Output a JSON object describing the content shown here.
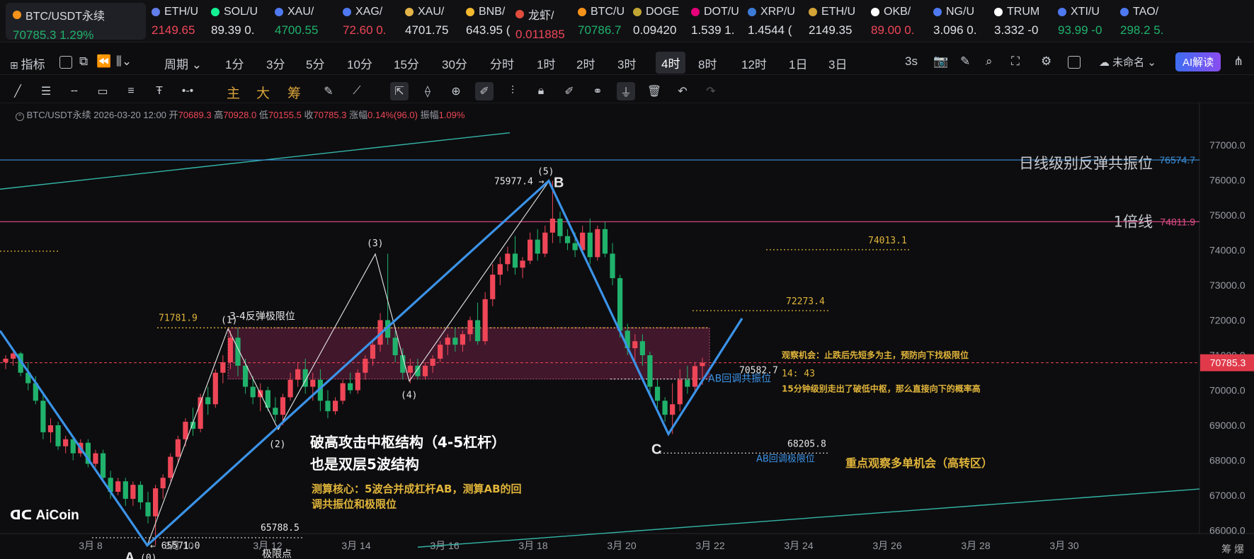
{
  "ticker": [
    {
      "name": "BTC/USDT永续",
      "price": "70785.3",
      "change": "1.29%",
      "dir": "up",
      "color": "#f7931a"
    },
    {
      "name": "ETH/U",
      "price": "2149.65",
      "change": "",
      "dir": "dn",
      "color": "#627eea"
    },
    {
      "name": "SOL/U",
      "price": "89.39",
      "change": "0.",
      "dir": "wt",
      "color": "#14f195"
    },
    {
      "name": "XAU/",
      "price": "4700.55",
      "change": "",
      "dir": "up",
      "color": "#4e79f0"
    },
    {
      "name": "XAG/",
      "price": "72.60",
      "change": "0.",
      "dir": "dn",
      "color": "#4e79f0"
    },
    {
      "name": "XAU/",
      "price": "4701.75",
      "change": "",
      "dir": "wt",
      "color": "#e5b449"
    },
    {
      "name": "BNB/",
      "price": "643.95",
      "change": "(",
      "dir": "wt",
      "color": "#f3ba2f"
    },
    {
      "name": "龙虾/",
      "price": "0.011885",
      "change": "",
      "dir": "dn",
      "color": "#e14d3c"
    },
    {
      "name": "BTC/U",
      "price": "70786.7",
      "change": "",
      "dir": "up",
      "color": "#f7931a"
    },
    {
      "name": "DOGE",
      "price": "0.09420",
      "change": "",
      "dir": "wt",
      "color": "#c2a633"
    },
    {
      "name": "DOT/U",
      "price": "1.539",
      "change": "1.",
      "dir": "wt",
      "color": "#e6007a"
    },
    {
      "name": "XRP/U",
      "price": "1.4544",
      "change": "(",
      "dir": "wt",
      "color": "#3d7bd8"
    },
    {
      "name": "ETH/U",
      "price": "2149.35",
      "change": "",
      "dir": "wt",
      "color": "#d4a437"
    },
    {
      "name": "OKB/",
      "price": "89.00",
      "change": "0.",
      "dir": "dn",
      "color": "#ffffff"
    },
    {
      "name": "NG/U",
      "price": "3.096",
      "change": "0.",
      "dir": "wt",
      "color": "#4e79f0"
    },
    {
      "name": "TRUM",
      "price": "3.332",
      "change": "-0",
      "dir": "wt",
      "color": "#ffffff"
    },
    {
      "name": "XTI/U",
      "price": "93.99",
      "change": "-0",
      "dir": "up",
      "color": "#4e79f0"
    },
    {
      "name": "TAO/",
      "price": "298.2",
      "change": "5.",
      "dir": "up",
      "color": "#4e79f0"
    }
  ],
  "toolbar": {
    "indicator": "指标",
    "period": "周期",
    "intervals": [
      "1分",
      "3分",
      "5分",
      "10分",
      "15分",
      "30分",
      "分时",
      "1时",
      "2时",
      "3时",
      "4时",
      "8时",
      "12时",
      "1日",
      "3日"
    ],
    "active_interval": "4时",
    "refresh": "3s",
    "layout_name": "未命名",
    "ai_button": "AI解读"
  },
  "drawbar": {
    "main": "主",
    "big": "大",
    "chip": "筹"
  },
  "info": {
    "symbol": "BTC/USDT永续",
    "time": "2026-03-20 12:00",
    "open_label": "开",
    "open": "70689.3",
    "high_label": "高",
    "high": "70928.0",
    "low_label": "低",
    "low": "70155.5",
    "close_label": "收",
    "close": "70785.3",
    "change_label": "涨幅",
    "change": "0.14%(96.0)",
    "amp_label": "振幅",
    "amp": "1.09%"
  },
  "brand": "AiCoin",
  "corner": "筹 爆",
  "chart_data": {
    "type": "candlestick",
    "ylim": [
      65000,
      77300
    ],
    "y_ticks": [
      "77000.0",
      "76000.0",
      "75000.0",
      "74000.0",
      "73000.0",
      "72000.0",
      "71000.0",
      "70000.0",
      "69000.0",
      "68000.0",
      "67000.0",
      "66000.0"
    ],
    "x_ticks": [
      {
        "label": "3月 8",
        "day": 8
      },
      {
        "label": "3月 10",
        "day": 10
      },
      {
        "label": "3月 12",
        "day": 12
      },
      {
        "label": "3月 14",
        "day": 14
      },
      {
        "label": "3月 16",
        "day": 16
      },
      {
        "label": "3月 18",
        "day": 18
      },
      {
        "label": "3月 20",
        "day": 20
      },
      {
        "label": "3月 22",
        "day": 22
      },
      {
        "label": "3月 24",
        "day": 24
      },
      {
        "label": "3月 26",
        "day": 26
      },
      {
        "label": "3月 28",
        "day": 28
      },
      {
        "label": "3月 30",
        "day": 30
      }
    ],
    "last_price": "70785.3",
    "candles": [
      [
        70800,
        71000,
        70600,
        70900
      ],
      [
        70900,
        71100,
        70700,
        71050
      ],
      [
        71050,
        71100,
        70400,
        70500
      ],
      [
        70500,
        70800,
        70000,
        70200
      ],
      [
        70200,
        70400,
        69600,
        69700
      ],
      [
        69700,
        69900,
        68600,
        68800
      ],
      [
        68800,
        69200,
        68500,
        69000
      ],
      [
        69000,
        69100,
        68300,
        68400
      ],
      [
        68400,
        68700,
        68200,
        68600
      ],
      [
        68600,
        68700,
        68000,
        68200
      ],
      [
        68200,
        68600,
        68100,
        68500
      ],
      [
        68500,
        68600,
        67800,
        67900
      ],
      [
        67900,
        68300,
        67800,
        68200
      ],
      [
        68200,
        68300,
        67400,
        67500
      ],
      [
        67500,
        67700,
        66900,
        67100
      ],
      [
        67100,
        67500,
        67000,
        67400
      ],
      [
        67400,
        67500,
        66700,
        66900
      ],
      [
        66900,
        67400,
        66700,
        67300
      ],
      [
        67300,
        67400,
        66600,
        66800
      ],
      [
        66800,
        67100,
        66200,
        66400
      ],
      [
        66400,
        67300,
        65571,
        67200
      ],
      [
        67200,
        67600,
        66900,
        67500
      ],
      [
        67500,
        68200,
        67400,
        68100
      ],
      [
        68100,
        68700,
        67900,
        68600
      ],
      [
        68600,
        69200,
        68400,
        69100
      ],
      [
        69100,
        69500,
        68700,
        68900
      ],
      [
        68900,
        69900,
        68800,
        69800
      ],
      [
        69800,
        70100,
        69300,
        69600
      ],
      [
        69600,
        70600,
        69500,
        70500
      ],
      [
        70500,
        71000,
        70200,
        70800
      ],
      [
        70800,
        71700,
        70600,
        71500
      ],
      [
        71500,
        71782,
        70400,
        70700
      ],
      [
        70700,
        70900,
        69900,
        70100
      ],
      [
        70100,
        70400,
        69600,
        69800
      ],
      [
        69800,
        70200,
        69400,
        70000
      ],
      [
        70000,
        70100,
        69400,
        69500
      ],
      [
        69500,
        69800,
        69100,
        69300
      ],
      [
        69300,
        69900,
        69000,
        69800
      ],
      [
        69800,
        70500,
        69700,
        70300
      ],
      [
        70300,
        70800,
        70100,
        70600
      ],
      [
        70600,
        70900,
        69900,
        70100
      ],
      [
        70100,
        70500,
        69700,
        70300
      ],
      [
        70300,
        70600,
        69400,
        69700
      ],
      [
        69700,
        70000,
        69200,
        69400
      ],
      [
        69400,
        69800,
        69300,
        69700
      ],
      [
        69700,
        70300,
        69600,
        70200
      ],
      [
        70200,
        70500,
        69900,
        70000
      ],
      [
        70000,
        70600,
        69900,
        70500
      ],
      [
        70500,
        71000,
        70300,
        70900
      ],
      [
        70900,
        71400,
        70700,
        71300
      ],
      [
        71300,
        72200,
        71100,
        72000
      ],
      [
        72000,
        73900,
        71300,
        71500
      ],
      [
        71500,
        71700,
        70800,
        71000
      ],
      [
        71000,
        71200,
        70300,
        70500
      ],
      [
        70500,
        70900,
        70200,
        70700
      ],
      [
        70700,
        70900,
        70300,
        70400
      ],
      [
        70400,
        70800,
        70300,
        70700
      ],
      [
        70700,
        71000,
        70500,
        70900
      ],
      [
        70900,
        71400,
        70800,
        71300
      ],
      [
        71300,
        71600,
        71000,
        71500
      ],
      [
        71500,
        71800,
        71100,
        71300
      ],
      [
        71300,
        71700,
        71100,
        71600
      ],
      [
        71600,
        72100,
        71400,
        72000
      ],
      [
        72000,
        72500,
        71300,
        71400
      ],
      [
        71400,
        72800,
        71300,
        72600
      ],
      [
        72600,
        73600,
        72400,
        73300
      ],
      [
        73300,
        73800,
        73000,
        73600
      ],
      [
        73600,
        74100,
        73400,
        73900
      ],
      [
        73900,
        74400,
        73300,
        73500
      ],
      [
        73500,
        73800,
        73200,
        73700
      ],
      [
        73700,
        74500,
        73600,
        74300
      ],
      [
        74300,
        74600,
        73700,
        73900
      ],
      [
        73900,
        74700,
        73800,
        74500
      ],
      [
        74500,
        75978,
        74200,
        74900
      ],
      [
        74900,
        75100,
        74200,
        74400
      ],
      [
        74400,
        74600,
        74000,
        74200
      ],
      [
        74200,
        74500,
        73800,
        74000
      ],
      [
        74000,
        74700,
        73900,
        74500
      ],
      [
        74500,
        74900,
        73600,
        73800
      ],
      [
        73800,
        74700,
        73700,
        74600
      ],
      [
        74600,
        74800,
        73800,
        73900
      ],
      [
        73900,
        74200,
        73000,
        73200
      ],
      [
        73200,
        73300,
        71500,
        71700
      ],
      [
        71700,
        71900,
        71000,
        71200
      ],
      [
        71200,
        71600,
        70800,
        71400
      ],
      [
        71400,
        71600,
        70700,
        71000
      ],
      [
        71000,
        71100,
        69900,
        70100
      ],
      [
        70100,
        70300,
        69500,
        69700
      ],
      [
        69700,
        69800,
        69100,
        69300
      ],
      [
        69300,
        70200,
        68750,
        69600
      ],
      [
        69600,
        70600,
        69400,
        70300
      ],
      [
        70300,
        70700,
        69900,
        70100
      ],
      [
        70100,
        70800,
        70000,
        70690
      ],
      [
        70689,
        70928,
        70155,
        70785
      ]
    ],
    "levels": [
      {
        "price": 76574.7,
        "label": "76574.7",
        "color": "#3a8fdc",
        "text": "日线级别反弹共振位"
      },
      {
        "price": 74811.9,
        "label": "74811.9",
        "color": "#e04d8a",
        "text": "1倍线"
      }
    ],
    "fib_points": [
      {
        "text": "(1)"
      },
      {
        "text": "(2)"
      },
      {
        "text": "(3)"
      },
      {
        "text": "(4)"
      },
      {
        "text": "(5)"
      },
      {
        "text": "(0)"
      }
    ],
    "abc_labels": [
      "A",
      "B",
      "C"
    ],
    "annotations": {
      "p71781": "71781.9",
      "limit34": "3-4反弹极限位",
      "p65571": "65571.0",
      "p65788": "65788.5",
      "extreme": "极限点",
      "p75977": "75977.4",
      "p74013": "74013.1",
      "p72273": "72273.4",
      "p70582": "70582.7",
      "p68205": "68205.8",
      "resonance": "AB回调共振位",
      "limit_ab": "AB回调极限位",
      "timer": "14: 43",
      "obs1": "观察机会：止跌后先短多为主，预防向下找极限位",
      "obs2": "15分钟级别走出了破低中枢，那么直接向下的概率高",
      "focus": "重点观察多单机会（高转区）",
      "main1": "破高攻击中枢结构（4-5杠杆）",
      "main2": "也是双层5波结构",
      "calc1": "测算核心：5波合并成杠杆AB，测算AB的回",
      "calc2": "调共振位和极限位"
    }
  }
}
